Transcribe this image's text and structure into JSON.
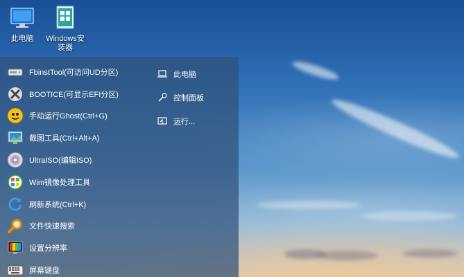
{
  "desktop": {
    "icons": [
      {
        "label": "此电脑",
        "icon": "computer-icon"
      },
      {
        "label": "Windows安装器",
        "icon": "windows-installer-icon"
      }
    ]
  },
  "start_menu": {
    "left_items": [
      {
        "label": "FbinstTool(可访问UD分区)",
        "icon": "drive-icon"
      },
      {
        "label": "BOOTICE(可显示EFI分区)",
        "icon": "bootice-icon"
      },
      {
        "label": "手动运行Ghost(Ctrl+G)",
        "icon": "ghost-icon"
      },
      {
        "label": "截图工具(Ctrl+Alt+A)",
        "icon": "screenshot-icon"
      },
      {
        "label": "UltraISO(编辑ISO)",
        "icon": "disc-icon"
      },
      {
        "label": "Wim镜像处理工具",
        "icon": "wim-tool-icon"
      },
      {
        "label": "刷新系统(Ctrl+K)",
        "icon": "refresh-icon"
      },
      {
        "label": "文件快速搜索",
        "icon": "search-icon"
      },
      {
        "label": "设置分辨率",
        "icon": "resolution-icon"
      },
      {
        "label": "屏幕键盘",
        "icon": "keyboard-icon"
      }
    ],
    "right_items": [
      {
        "label": "此电脑",
        "icon": "laptop-icon"
      },
      {
        "label": "控制面板",
        "icon": "wrench-icon"
      },
      {
        "label": "运行...",
        "icon": "run-icon"
      }
    ]
  }
}
